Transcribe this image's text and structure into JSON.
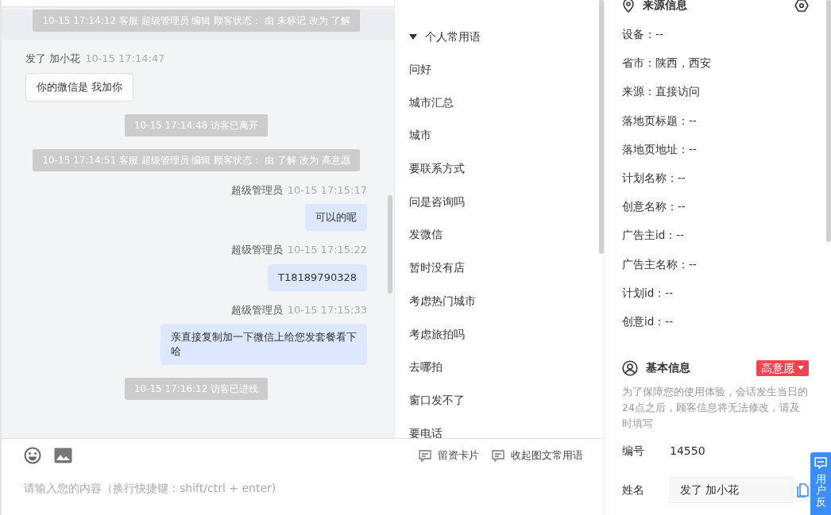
{
  "chat": {
    "messages": [
      {
        "kind": "system",
        "text": "10-15 17:14:12 客服 超级管理员 编辑 顾客状态： 由 未标记 改为 了解",
        "highlighted": true
      },
      {
        "kind": "visitor",
        "sender": "发了 加小花",
        "time": "10-15 17:14:47",
        "text": "你的微信是 我加你"
      },
      {
        "kind": "system",
        "text": "10-15 17:14:48 访客已离开",
        "highlighted": false
      },
      {
        "kind": "system",
        "text": "10-15 17:14:51 客服 超级管理员 编辑 顾客状态： 由 了解 改为 高意愿",
        "highlighted": false
      },
      {
        "kind": "agent",
        "sender": "超级管理员",
        "time": "10-15 17:15:17",
        "text": "可以的呢"
      },
      {
        "kind": "agent",
        "sender": "超级管理员",
        "time": "10-15 17:15:22",
        "text": "T18189790328"
      },
      {
        "kind": "agent",
        "sender": "超级管理员",
        "time": "10-15 17:15:33",
        "text": "亲直接复制加一下微信上给您发套餐看下哈"
      },
      {
        "kind": "system",
        "text": "10-15 17:16:12 访客已进线",
        "highlighted": false
      }
    ]
  },
  "phrases": {
    "group": {
      "label": "个人常用语",
      "expanded": true
    },
    "items": [
      "问好",
      "城市汇总",
      "城市",
      "要联系方式",
      "问是咨询吗",
      "发微信",
      "暂时没有店",
      "考虑热门城市",
      "考虑旅拍吗",
      "去哪拍",
      "窗口发不了",
      "要电话"
    ]
  },
  "composer": {
    "tools": [
      "留资卡片",
      "收起图文常用语"
    ],
    "placeholder": "请输入您的内容（换行快捷键：shift/ctrl + enter)"
  },
  "source_info": {
    "title": "来源信息",
    "fields": [
      "设备：--",
      "省市：陕西，西安",
      "来源：直接访问",
      "落地页标题：--",
      "落地页地址：--",
      "计划名称：--",
      "创意名称：--",
      "广告主id：--",
      "广告主名称：--",
      "计划id：--",
      "创意id：--"
    ]
  },
  "basic_info": {
    "title": "基本信息",
    "status": {
      "label": "高意愿",
      "color": "#f5424f"
    },
    "notice": "为了保障您的使用体验，会话发生当日的24点之后，顾客信息将无法修改，请及时填写",
    "rows": [
      {
        "kind": "text",
        "label": "编号",
        "value": "14550"
      },
      {
        "kind": "input",
        "label": "姓名",
        "value": "发了 加小花"
      }
    ]
  },
  "feedback_tab": {
    "label": "用户反"
  }
}
